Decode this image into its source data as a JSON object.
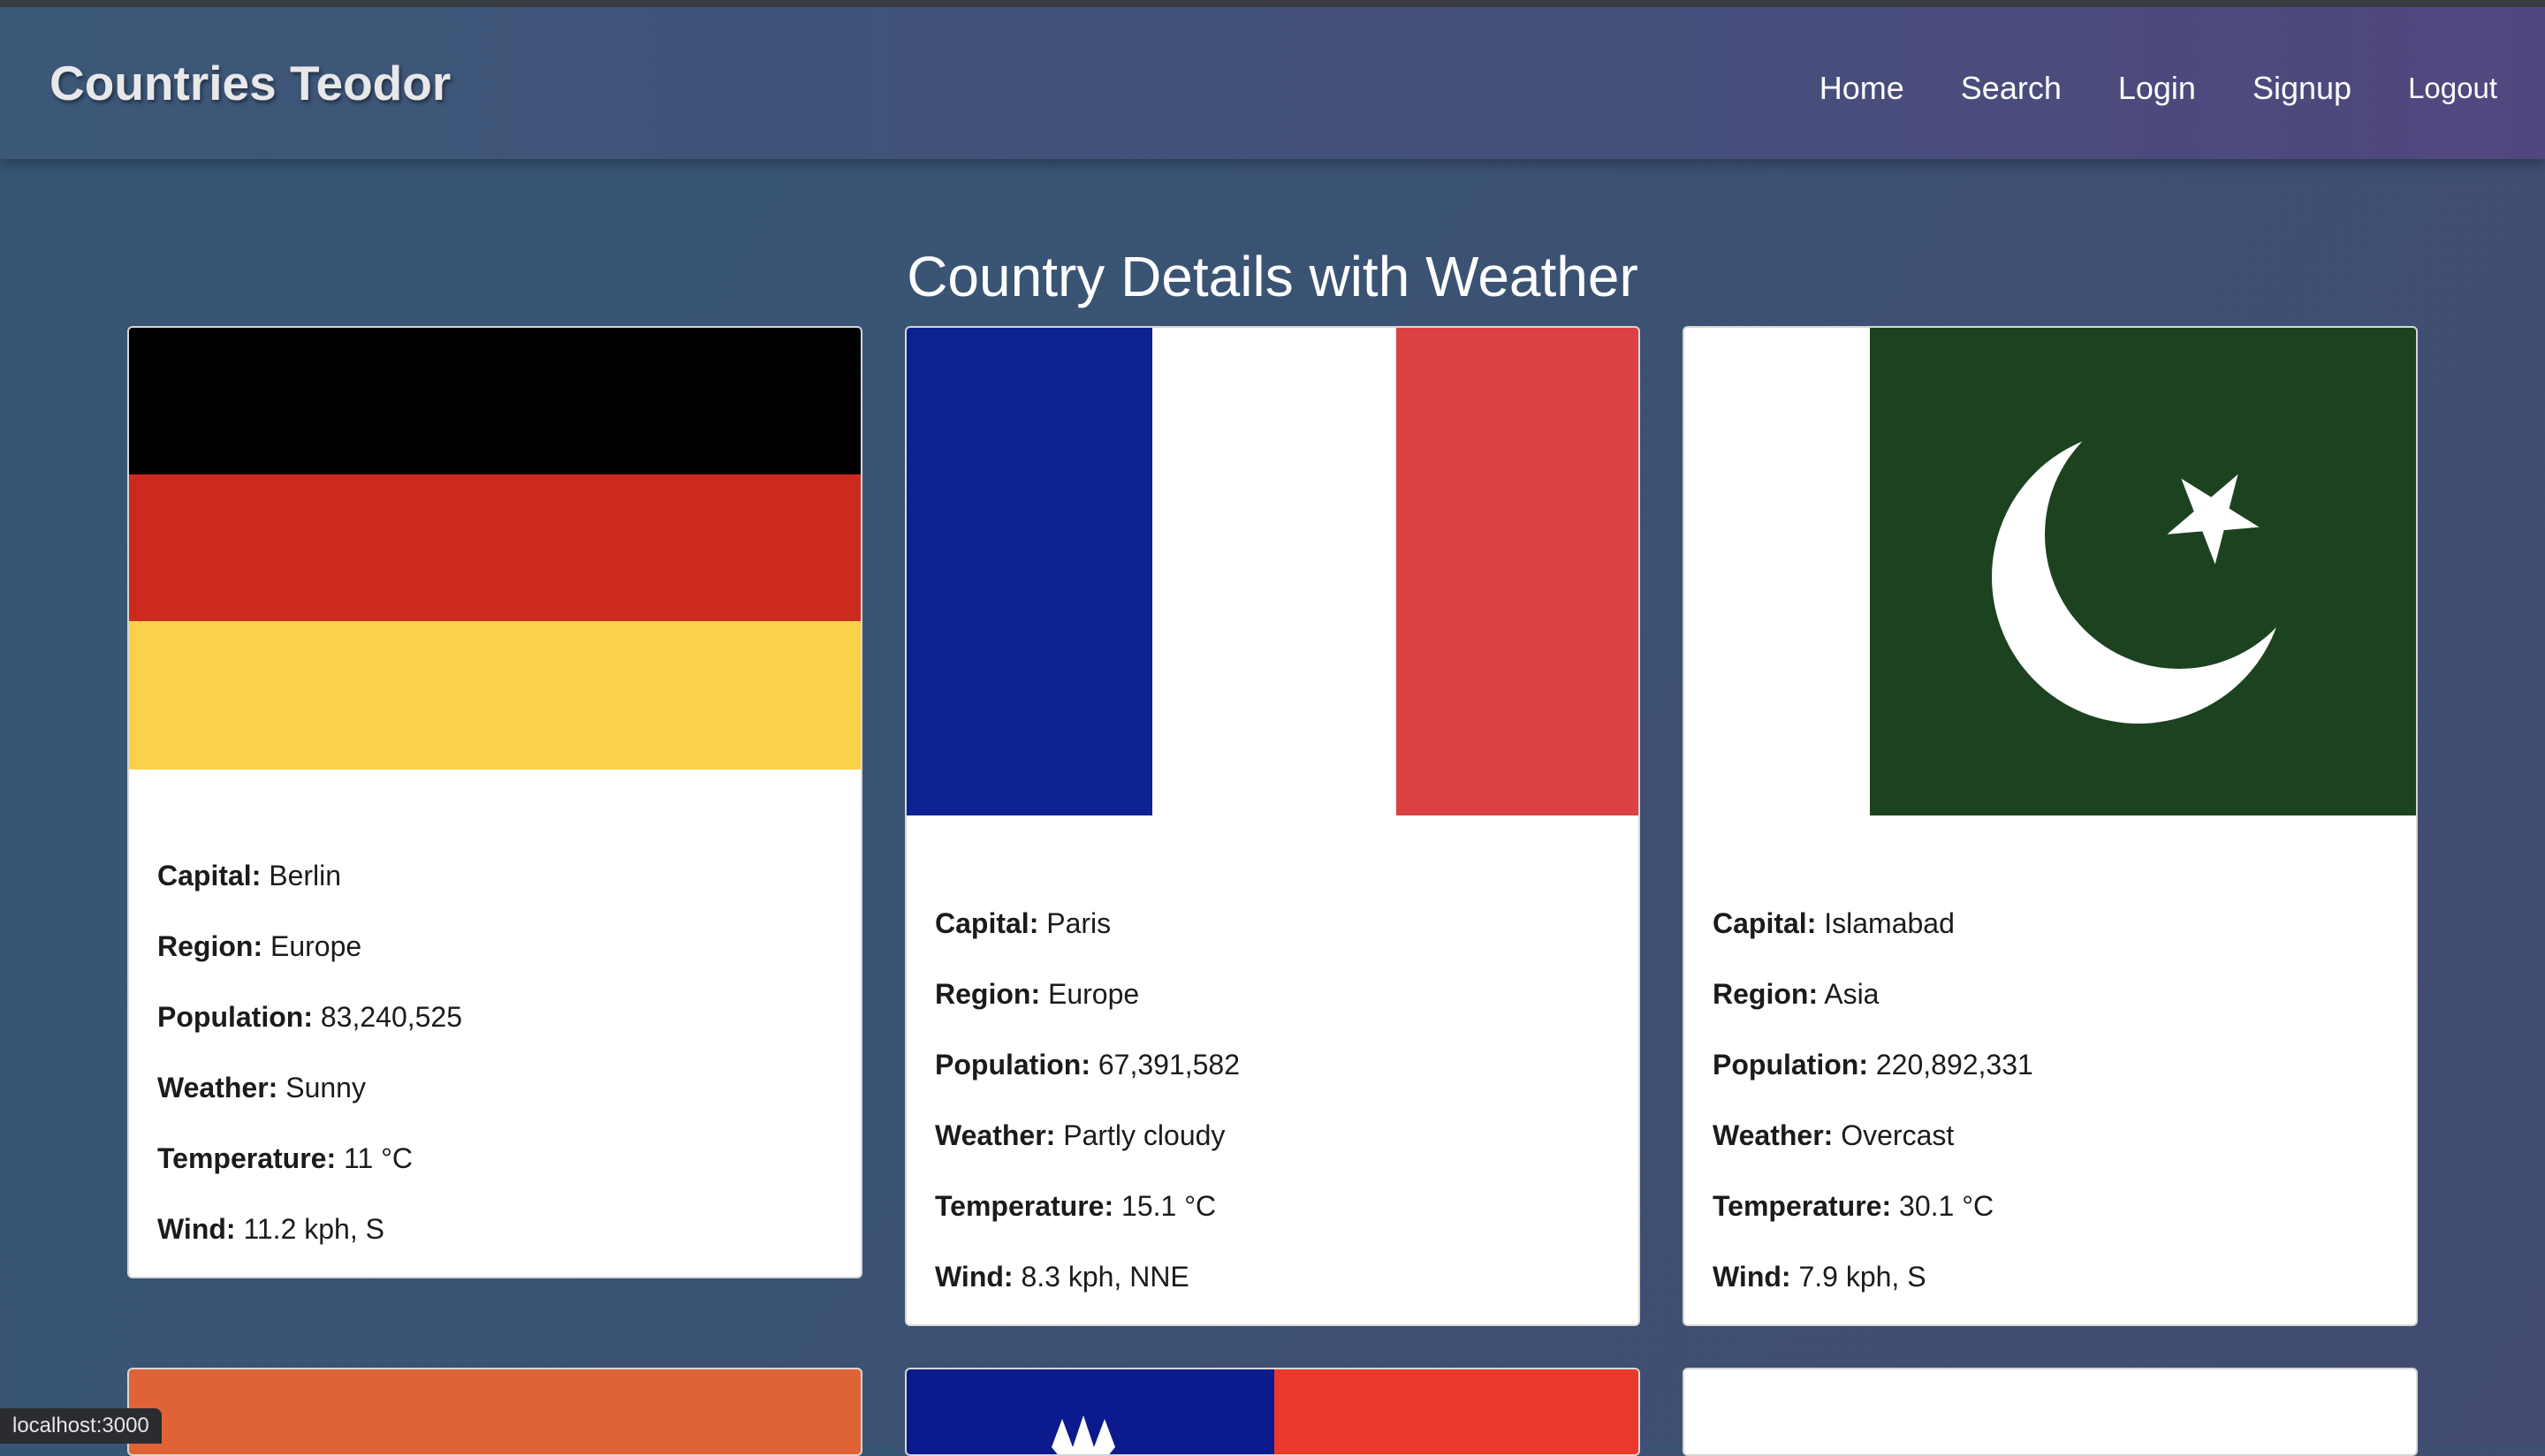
{
  "nav": {
    "brand": "Countries Teodor",
    "links": [
      "Home",
      "Search",
      "Login",
      "Signup"
    ],
    "logout": "Logout"
  },
  "page_title": "Country Details with Weather",
  "labels": {
    "capital": "Capital:",
    "region": "Region:",
    "population": "Population:",
    "weather": "Weather:",
    "temperature": "Temperature:",
    "wind": "Wind:"
  },
  "cards": [
    {
      "flag_icon": "germany-flag-icon",
      "flag_colors": [
        "#000000",
        "#cc2a1e",
        "#f9d24a"
      ],
      "capital": "Berlin",
      "region": "Europe",
      "population": "83,240,525",
      "weather": "Sunny",
      "temperature": "11 °C",
      "wind": "11.2 kph, S"
    },
    {
      "flag_icon": "france-flag-icon",
      "flag_colors": [
        "#0c2290",
        "#ffffff",
        "#dc4244"
      ],
      "capital": "Paris",
      "region": "Europe",
      "population": "67,391,582",
      "weather": "Partly cloudy",
      "temperature": "15.1 °C",
      "wind": "8.3 kph, NNE"
    },
    {
      "flag_icon": "pakistan-flag-icon",
      "flag_colors": [
        "#ffffff",
        "#1c4220"
      ],
      "capital": "Islamabad",
      "region": "Asia",
      "population": "220,892,331",
      "weather": "Overcast",
      "temperature": "30.1 °C",
      "wind": "7.9 kph, S"
    }
  ],
  "partial_flags": {
    "left_color": "#e06337",
    "middle_colors": [
      "#0b1a8c",
      "#e8392a"
    ],
    "right_color": "#ffffff"
  },
  "status_bar": "localhost:3000"
}
